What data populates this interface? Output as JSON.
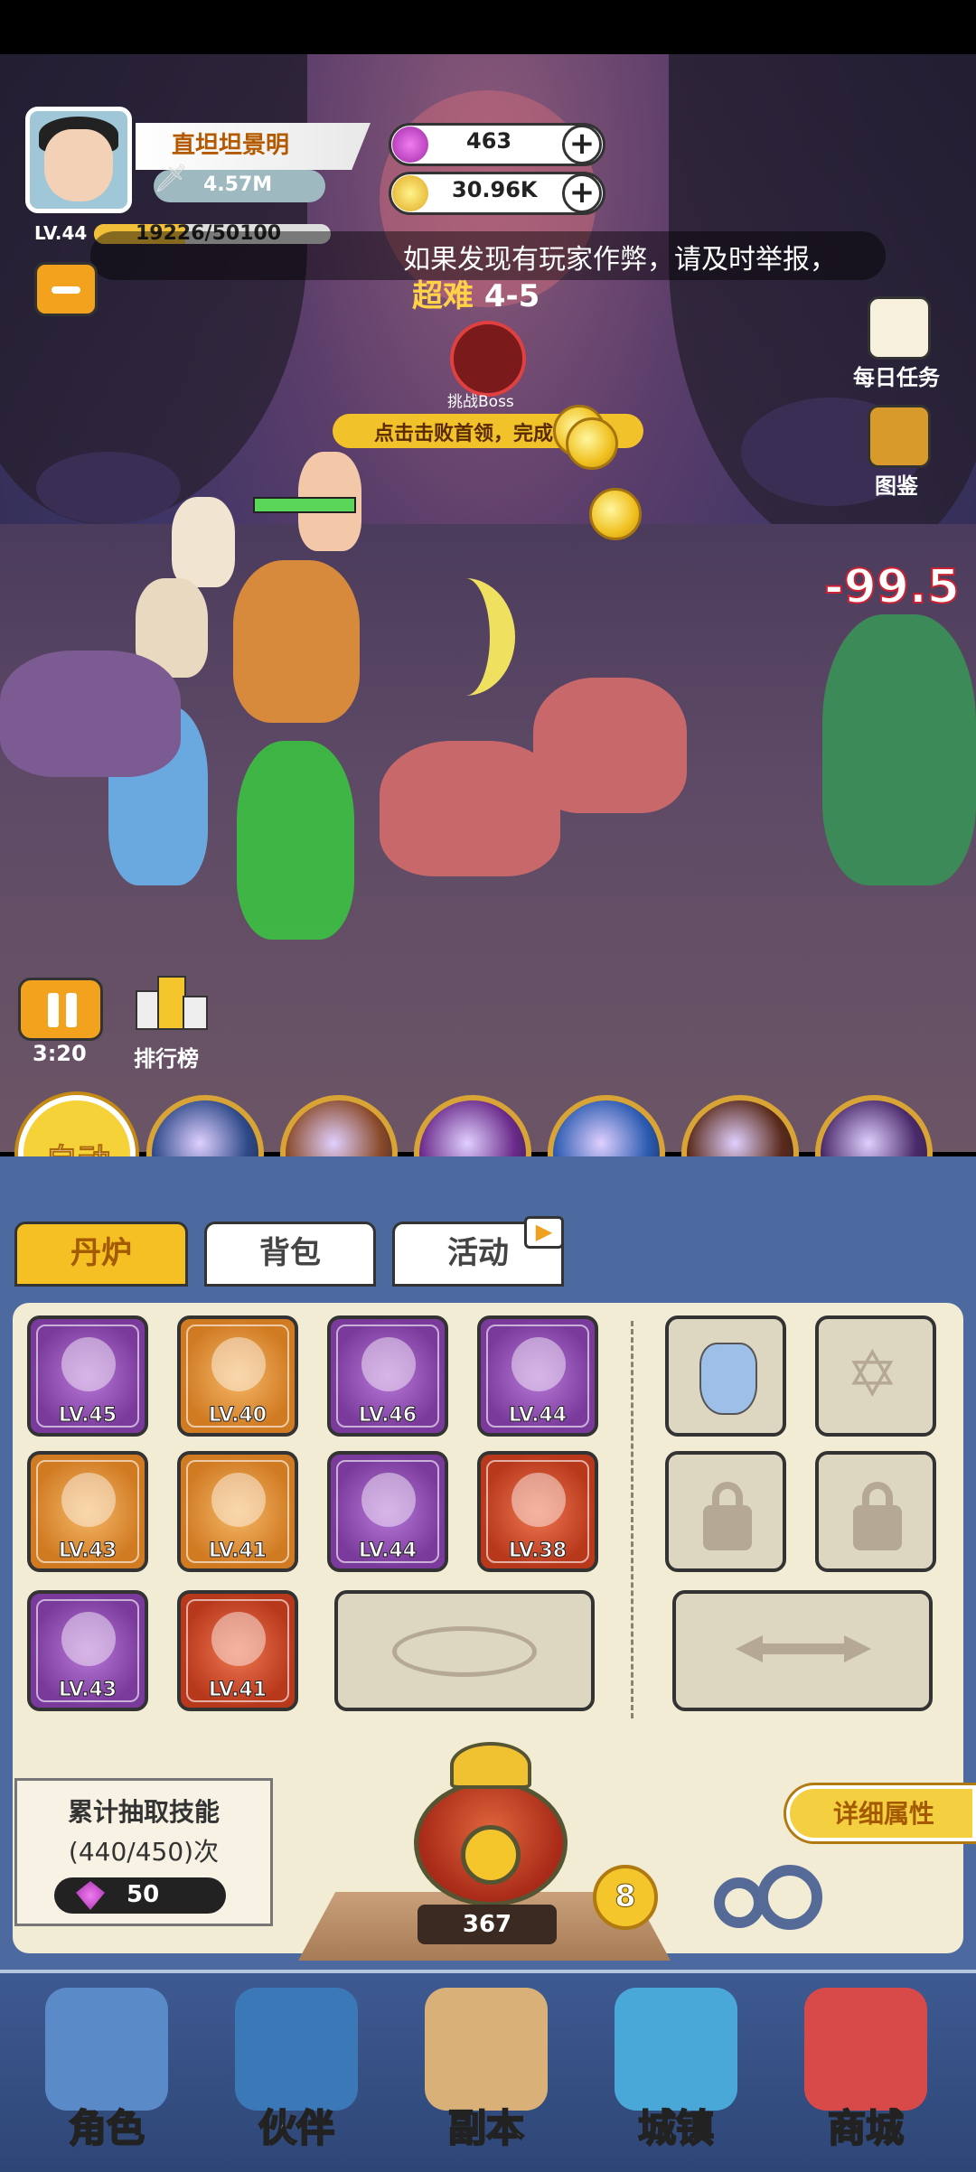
{
  "player": {
    "name": "直坦坦景明",
    "power": "4.57M",
    "level": "LV.44",
    "exp_text": "19226/50100",
    "exp_fraction": 0.3838
  },
  "currency": {
    "gems": "463",
    "gold": "30.96K"
  },
  "notice": "如果发现有玩家作弊，请及时举报，",
  "stage": {
    "difficulty": "超难",
    "number": "4-5",
    "boss_label": "挑战Boss",
    "hint": "点击击败首领，完成"
  },
  "side_menu": {
    "daily_tasks": "每日任务",
    "collection": "图鉴"
  },
  "damage_text": "-99.5",
  "battle": {
    "timer": "3:20",
    "rank_label": "排行榜"
  },
  "skills": {
    "auto_label": "自动",
    "skill_colors": [
      "#2f4a8a",
      "#8a4a2a",
      "#6a2a8a",
      "#2a5ab0",
      "#5a2a1a",
      "#4a2a6a"
    ]
  },
  "tabs": [
    {
      "label": "丹炉",
      "active": true
    },
    {
      "label": "背包",
      "active": false
    },
    {
      "label": "活动",
      "active": false
    }
  ],
  "items": [
    {
      "lv": "LV.45",
      "rarity": "purple"
    },
    {
      "lv": "LV.40",
      "rarity": "orange"
    },
    {
      "lv": "LV.46",
      "rarity": "purple"
    },
    {
      "lv": "LV.44",
      "rarity": "purple"
    },
    {
      "lv": "LV.43",
      "rarity": "orange"
    },
    {
      "lv": "LV.41",
      "rarity": "orange"
    },
    {
      "lv": "LV.44",
      "rarity": "purple"
    },
    {
      "lv": "LV.38",
      "rarity": "red"
    },
    {
      "lv": "LV.43",
      "rarity": "purple"
    },
    {
      "lv": "LV.41",
      "rarity": "red"
    }
  ],
  "draw_stats": {
    "title": "累计抽取技能",
    "count": "(440/450)次",
    "gem_cost": "50"
  },
  "furnace": {
    "count": "367",
    "badge": "8"
  },
  "detail_button": "详细属性",
  "nav": [
    {
      "label": "角色",
      "icon": "character-icon"
    },
    {
      "label": "伙伴",
      "icon": "partner-icon"
    },
    {
      "label": "副本",
      "icon": "dungeon-icon"
    },
    {
      "label": "城镇",
      "icon": "town-icon"
    },
    {
      "label": "商城",
      "icon": "shop-icon"
    }
  ]
}
